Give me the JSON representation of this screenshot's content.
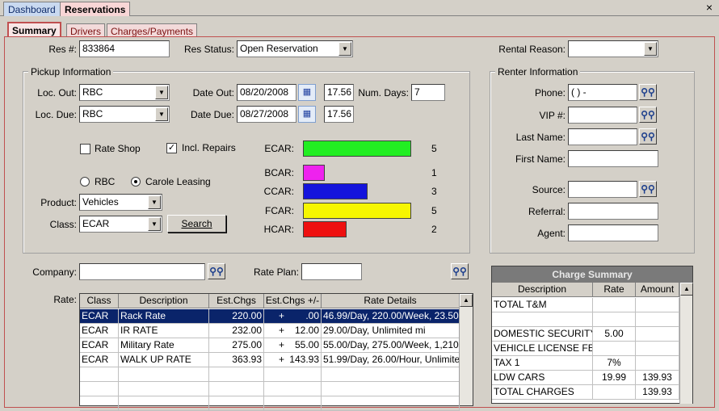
{
  "top_tabs": [
    "Dashboard",
    "Reservations"
  ],
  "close_label": "×",
  "sub_tabs": [
    "Summary",
    "Drivers",
    "Charges/Payments"
  ],
  "res": {
    "res_no_label": "Res #:",
    "res_no": "833864",
    "status_label": "Res Status:",
    "status": "Open Reservation",
    "rental_reason_label": "Rental Reason:",
    "rental_reason": ""
  },
  "pickup": {
    "title": "Pickup Information",
    "loc_out_label": "Loc. Out:",
    "loc_out": "RBC",
    "loc_due_label": "Loc. Due:",
    "loc_due": "RBC",
    "date_out_label": "Date Out:",
    "date_out": "08/20/2008",
    "time_out": "17.56",
    "date_due_label": "Date Due:",
    "date_due": "08/27/2008",
    "time_due": "17.56",
    "num_days_label": "Num. Days:",
    "num_days": "7",
    "rate_shop_label": "Rate Shop",
    "incl_repairs_label": "Incl. Repairs",
    "radio_rbc": "RBC",
    "radio_carole": "Carole Leasing",
    "product_label": "Product:",
    "product": "Vehicles",
    "class_label": "Class:",
    "class": "ECAR",
    "search_label": "Search"
  },
  "chart_data": {
    "type": "bar",
    "categories": [
      "ECAR",
      "BCAR",
      "CCAR",
      "FCAR",
      "HCAR"
    ],
    "values": [
      5,
      1,
      3,
      5,
      2
    ],
    "colors": [
      "#22ee22",
      "#ee22ee",
      "#1414dc",
      "#f6f600",
      "#ee1010"
    ],
    "cat_labels": [
      "ECAR:",
      "BCAR:",
      "CCAR:",
      "FCAR:",
      "HCAR:"
    ],
    "xlim": [
      0,
      5
    ]
  },
  "renter": {
    "title": "Renter Information",
    "phone_label": "Phone:",
    "phone": "(  )    -",
    "vip_label": "VIP #:",
    "last_name_label": "Last Name:",
    "first_name_label": "First Name:",
    "source_label": "Source:",
    "referral_label": "Referral:",
    "agent_label": "Agent:"
  },
  "company_label": "Company:",
  "rate_plan_label": "Rate Plan:",
  "rate_label": "Rate:",
  "rates": {
    "columns": [
      "Class",
      "Description",
      "Est.Chgs",
      "Est.Chgs +/-",
      "Rate Details"
    ],
    "rows": [
      {
        "cls": "ECAR",
        "desc": "Rack Rate",
        "est": "220.00",
        "sign": "+",
        "delta": ".00",
        "details": "46.99/Day, 220.00/Week, 23.50"
      },
      {
        "cls": "ECAR",
        "desc": "IR RATE",
        "est": "232.00",
        "sign": "+",
        "delta": "12.00",
        "details": "29.00/Day, Unlimited mi"
      },
      {
        "cls": "ECAR",
        "desc": "Military Rate",
        "est": "275.00",
        "sign": "+",
        "delta": "55.00",
        "details": "55.00/Day, 275.00/Week, 1,210"
      },
      {
        "cls": "ECAR",
        "desc": "WALK UP RATE",
        "est": "363.93",
        "sign": "+",
        "delta": "143.93",
        "details": "51.99/Day, 26.00/Hour, Unlimite"
      }
    ]
  },
  "charge_summary": {
    "title": "Charge Summary",
    "columns": [
      "Description",
      "Rate",
      "Amount"
    ],
    "rows": [
      {
        "desc": "TOTAL T&M",
        "rate": "",
        "amount": ""
      },
      {
        "desc": "",
        "rate": "",
        "amount": ""
      },
      {
        "desc": "DOMESTIC SECURITY",
        "rate": "5.00",
        "amount": ""
      },
      {
        "desc": "VEHICLE LICENSE FEE",
        "rate": "",
        "amount": ""
      },
      {
        "desc": "TAX 1",
        "rate": "7%",
        "amount": ""
      },
      {
        "desc": "LDW CARS",
        "rate": "19.99",
        "amount": "139.93"
      },
      {
        "desc": "TOTAL CHARGES",
        "rate": "",
        "amount": "139.93"
      }
    ]
  }
}
